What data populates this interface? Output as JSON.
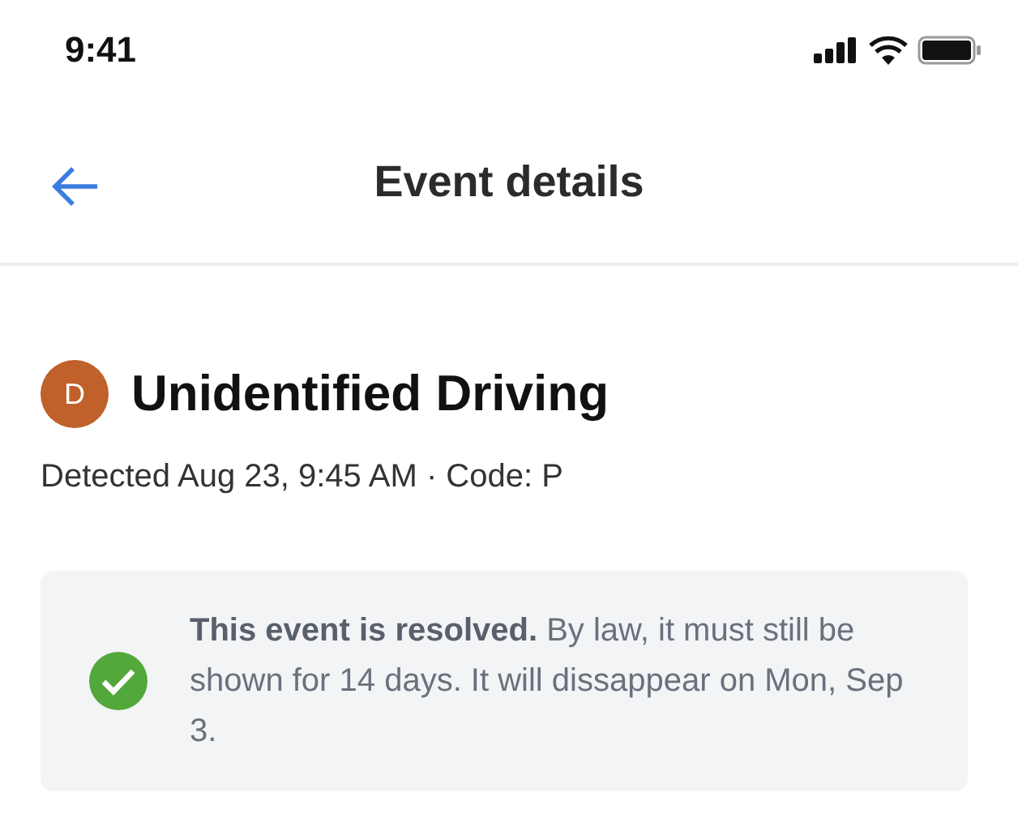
{
  "status_bar": {
    "time": "9:41"
  },
  "nav": {
    "title": "Event details"
  },
  "event": {
    "avatar_letter": "D",
    "title": "Unidentified Driving",
    "subtitle": "Detected Aug 23, 9:45 AM · Code: P"
  },
  "notice": {
    "text": "**This event is resolved.** By law, it must still be shown for 14 days. It will dissappear on Mon, Sep 3."
  }
}
